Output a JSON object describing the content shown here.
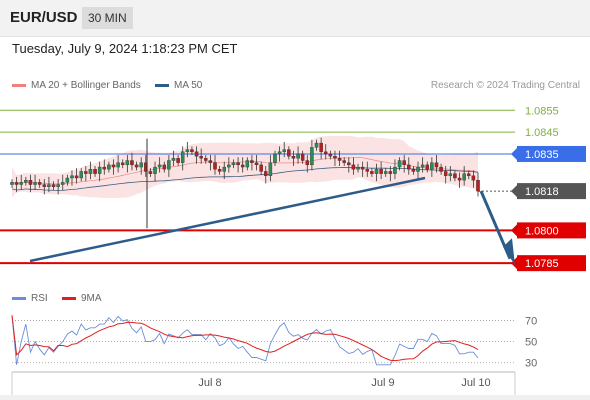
{
  "header": {
    "symbol": "EUR/USD",
    "timeframe": "30 MIN"
  },
  "datetime": "Tuesday, July 9, 2024 1:18:23 PM CET",
  "legend": {
    "ma20": {
      "label": "MA 20 + Bollinger Bands",
      "color": "#f08080"
    },
    "ma50": {
      "label": "MA 50",
      "color": "#2e5c8a"
    }
  },
  "credit": "Research © 2024 Trading Central",
  "rsi_legend": {
    "rsi": {
      "label": "RSI",
      "color": "#6a8fd8"
    },
    "ma9": {
      "label": "9MA",
      "color": "#e02020"
    }
  },
  "chart_data": [
    {
      "type": "candlestick",
      "ylim": [
        1.0775,
        1.0862
      ],
      "price_labels": [
        {
          "value": 1.0855,
          "label": "1.0855",
          "kind": "target",
          "color": "#7fb040"
        },
        {
          "value": 1.0845,
          "label": "1.0845",
          "kind": "target",
          "color": "#7fb040"
        },
        {
          "value": 1.0835,
          "label": "1.0835",
          "kind": "pivot",
          "color": "#3a6ee8"
        },
        {
          "value": 1.0818,
          "label": "1.0818",
          "kind": "last",
          "color": "#222222"
        },
        {
          "value": 1.08,
          "label": "1.0800",
          "kind": "target",
          "color": "#e00000"
        },
        {
          "value": 1.0785,
          "label": "1.0785",
          "kind": "target",
          "color": "#e00000"
        }
      ],
      "x_labels": [
        "Jul 8",
        "Jul 9",
        "Jul 10"
      ],
      "close": [
        1.0822,
        1.0821,
        1.0822,
        1.0823,
        1.0821,
        1.0822,
        1.0821,
        1.082,
        1.0821,
        1.082,
        1.0821,
        1.0822,
        1.0824,
        1.0825,
        1.0824,
        1.0827,
        1.0826,
        1.0828,
        1.0826,
        1.0829,
        1.0828,
        1.083,
        1.0829,
        1.0831,
        1.083,
        1.0832,
        1.083,
        1.0829,
        1.0831,
        1.0827,
        1.0826,
        1.0829,
        1.083,
        1.0828,
        1.0832,
        1.0833,
        1.0831,
        1.0836,
        1.0837,
        1.0836,
        1.0834,
        1.0833,
        1.0832,
        1.0831,
        1.0828,
        1.0827,
        1.0829,
        1.083,
        1.0831,
        1.083,
        1.0829,
        1.0832,
        1.0831,
        1.083,
        1.0827,
        1.0825,
        1.0831,
        1.0835,
        1.0836,
        1.0837,
        1.0834,
        1.0833,
        1.0835,
        1.0832,
        1.083,
        1.0838,
        1.084,
        1.0836,
        1.0835,
        1.0834,
        1.0833,
        1.0832,
        1.0831,
        1.083,
        1.0828,
        1.0829,
        1.0828,
        1.0827,
        1.0826,
        1.0828,
        1.0826,
        1.0827,
        1.0826,
        1.0829,
        1.0832,
        1.083,
        1.0828,
        1.0827,
        1.0829,
        1.083,
        1.0828,
        1.0831,
        1.0829,
        1.0827,
        1.0825,
        1.0826,
        1.0824,
        1.0823,
        1.0826,
        1.0825,
        1.0823,
        1.0818
      ],
      "rsi": {
        "ylim": [
          25,
          80
        ],
        "levels": [
          {
            "value": 70,
            "label": "70"
          },
          {
            "value": 50,
            "label": "50"
          },
          {
            "value": 30,
            "label": "30"
          }
        ]
      }
    }
  ]
}
